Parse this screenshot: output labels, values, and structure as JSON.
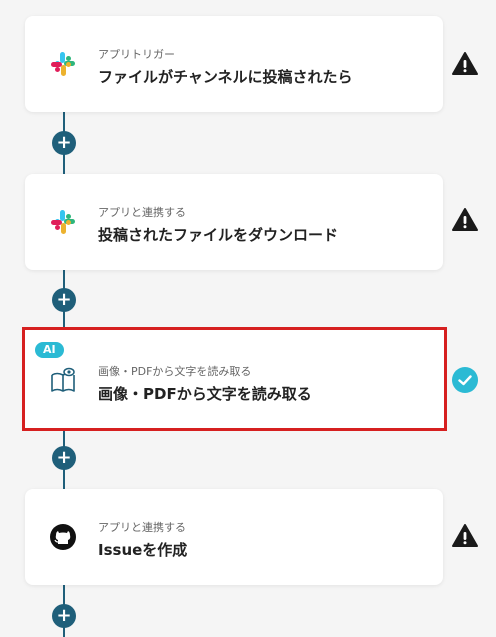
{
  "steps": [
    {
      "subtitle": "アプリトリガー",
      "title": "ファイルがチャンネルに投稿されたら",
      "app_icon": "slack-icon",
      "status": "warning"
    },
    {
      "subtitle": "アプリと連携する",
      "title": "投稿されたファイルをダウンロード",
      "app_icon": "slack-icon",
      "status": "warning"
    },
    {
      "badge": "AI",
      "subtitle": "画像・PDFから文字を読み取る",
      "title": "画像・PDFから文字を読み取る",
      "app_icon": "book-eye-icon",
      "status": "complete"
    },
    {
      "subtitle": "アプリと連携する",
      "title": "Issueを作成",
      "app_icon": "github-icon",
      "status": "warning"
    }
  ],
  "add_button_label": "+",
  "colors": {
    "accent": "#1f5f7a",
    "selected_border": "#d62020",
    "ai_badge": "#2bbad4",
    "complete": "#2bbad4",
    "warning": "#1a1a1a"
  }
}
